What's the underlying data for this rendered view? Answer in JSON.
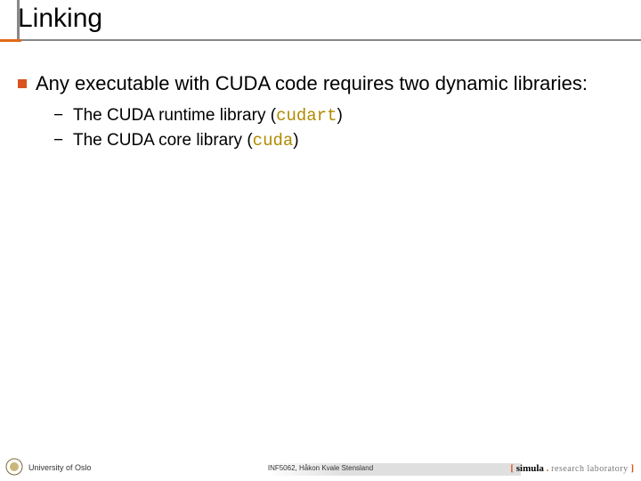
{
  "title": "Linking",
  "bullet": {
    "text": "Any executable with CUDA code requires two dynamic libraries:"
  },
  "subitems": [
    {
      "pre": "The CUDA runtime library (",
      "code": "cudart",
      "post": ")"
    },
    {
      "pre": "The CUDA core library (",
      "code": "cuda",
      "post": ")"
    }
  ],
  "footer": {
    "left": "University of Oslo",
    "center": "INF5062, Håkon Kvale Stensland",
    "right": {
      "open": "[ ",
      "brand": "simula",
      "dot": " . ",
      "rest": "research laboratory",
      "close": " ]"
    }
  }
}
